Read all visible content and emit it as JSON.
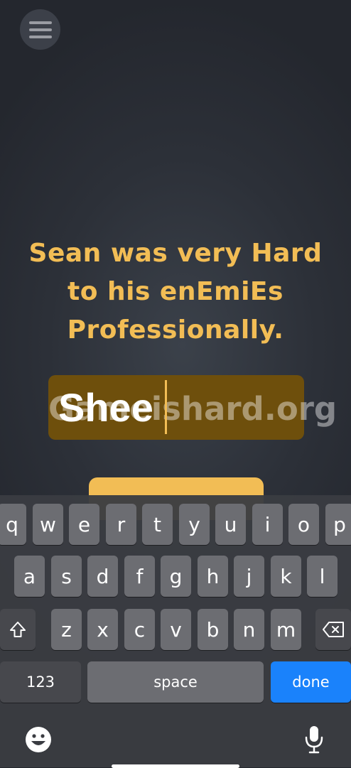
{
  "header": {
    "menu_icon": "hamburger-icon"
  },
  "prompt": {
    "lines": [
      "Sean was very Hard",
      "to his enEmiEs",
      "Professionally."
    ]
  },
  "answer": {
    "value": "Shee"
  },
  "watermark": {
    "text": "Gameishard.org"
  },
  "continue_button": {
    "label": ""
  },
  "keyboard": {
    "row1": [
      "q",
      "w",
      "e",
      "r",
      "t",
      "y",
      "u",
      "i",
      "o",
      "p"
    ],
    "row2": [
      "a",
      "s",
      "d",
      "f",
      "g",
      "h",
      "j",
      "k",
      "l"
    ],
    "row3": [
      "z",
      "x",
      "c",
      "v",
      "b",
      "n",
      "m"
    ],
    "shift_icon": "shift-icon",
    "backspace_icon": "backspace-icon",
    "numbers_label": "123",
    "space_label": "space",
    "done_label": "done",
    "emoji_icon": "emoji-icon",
    "mic_icon": "microphone-icon"
  },
  "colors": {
    "accent": "#f2bd55",
    "answer_box": "#6e4f0c",
    "done_key": "#1a82fb",
    "background": "#2c3038"
  }
}
